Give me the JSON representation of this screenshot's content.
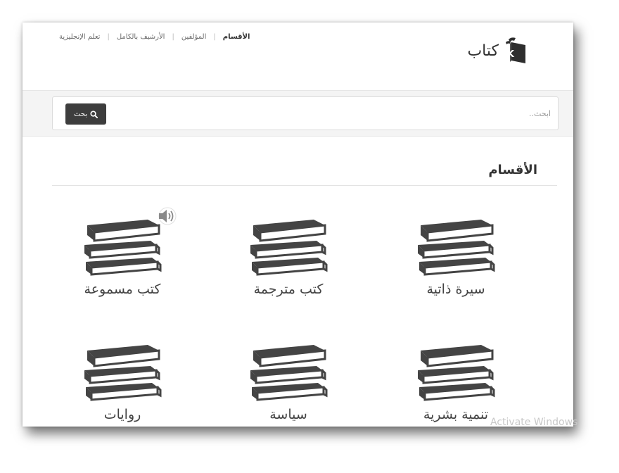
{
  "brand": {
    "name": "كتاب",
    "logo_letter": "K"
  },
  "nav": {
    "items": [
      {
        "label": "الأقسام",
        "active": true
      },
      {
        "label": "المؤلفين",
        "active": false
      },
      {
        "label": "الأرشيف بالكامل",
        "active": false
      },
      {
        "label": "تعلم الإنجليزية",
        "active": false
      }
    ]
  },
  "search": {
    "placeholder": "ابحث..",
    "button_label": "بحث"
  },
  "section": {
    "title": "الأقسام"
  },
  "categories": [
    {
      "label": "سيرة ذاتية"
    },
    {
      "label": "كتب مترجمة"
    },
    {
      "label": "كتب مسموعة",
      "has_audio_icon": true
    },
    {
      "label": "تنمية بشرية"
    },
    {
      "label": "سياسة"
    },
    {
      "label": "روايات"
    }
  ],
  "watermark": {
    "text": "Activate Windows"
  },
  "colors": {
    "accent": "#3d3d3d",
    "band": "#f4f4f4",
    "icon": "#444444"
  }
}
